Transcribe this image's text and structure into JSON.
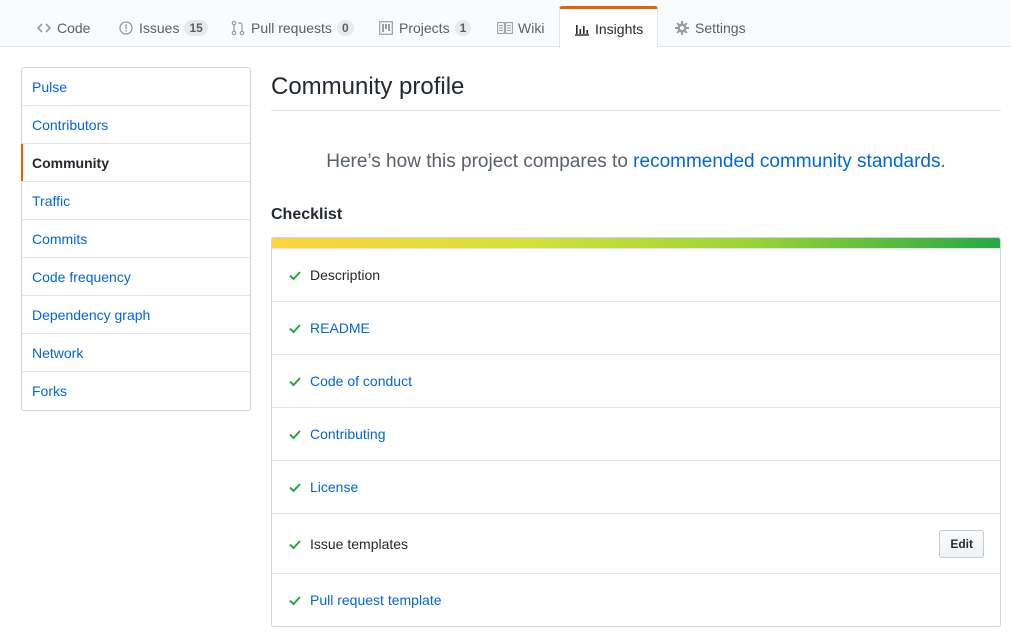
{
  "reponav": {
    "tabs": [
      {
        "label": "Code",
        "icon": "code-icon"
      },
      {
        "label": "Issues",
        "icon": "issue-icon",
        "count": "15"
      },
      {
        "label": "Pull requests",
        "icon": "pull-request-icon",
        "count": "0"
      },
      {
        "label": "Projects",
        "icon": "project-icon",
        "count": "1"
      },
      {
        "label": "Wiki",
        "icon": "book-icon"
      },
      {
        "label": "Insights",
        "icon": "graph-icon",
        "selected": true
      },
      {
        "label": "Settings",
        "icon": "gear-icon"
      }
    ],
    "accent_color": "#e36209"
  },
  "sidebar": {
    "items": [
      {
        "label": "Pulse"
      },
      {
        "label": "Contributors"
      },
      {
        "label": "Community",
        "selected": true
      },
      {
        "label": "Traffic"
      },
      {
        "label": "Commits"
      },
      {
        "label": "Code frequency"
      },
      {
        "label": "Dependency graph"
      },
      {
        "label": "Network"
      },
      {
        "label": "Forks"
      }
    ]
  },
  "main": {
    "title": "Community profile",
    "lead_prefix": "Here’s how this project compares to ",
    "lead_link": "recommended community standards",
    "lead_suffix": ".",
    "checklist_title": "Checklist",
    "progress_percent": 100,
    "checklist": [
      {
        "label": "Description",
        "done": true,
        "link": false
      },
      {
        "label": "README",
        "done": true,
        "link": true
      },
      {
        "label": "Code of conduct",
        "done": true,
        "link": true
      },
      {
        "label": "Contributing",
        "done": true,
        "link": true
      },
      {
        "label": "License",
        "done": true,
        "link": true
      },
      {
        "label": "Issue templates",
        "done": true,
        "link": false,
        "action": "Edit"
      },
      {
        "label": "Pull request template",
        "done": true,
        "link": true
      }
    ]
  }
}
